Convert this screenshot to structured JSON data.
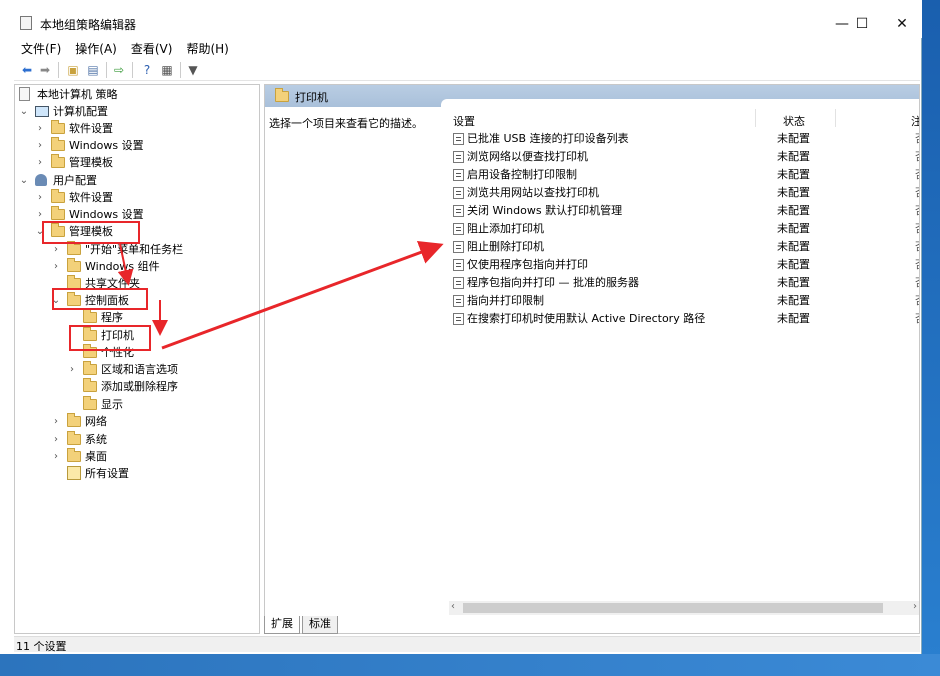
{
  "window": {
    "title": "本地组策略编辑器",
    "minimize": "—",
    "maximize": "☐",
    "close": "✕"
  },
  "menu": [
    "文件(F)",
    "操作(A)",
    "查看(V)",
    "帮助(H)"
  ],
  "tree": {
    "root": "本地计算机 策略",
    "computer_config": "计算机配置",
    "cc_software": "软件设置",
    "cc_windows": "Windows 设置",
    "cc_admin": "管理模板",
    "user_config": "用户配置",
    "uc_software": "软件设置",
    "uc_windows": "Windows 设置",
    "uc_admin": "管理模板",
    "start_menu": "\"开始\"菜单和任务栏",
    "win_components": "Windows 组件",
    "shared_folders": "共享文件夹",
    "control_panel": "控制面板",
    "programs": "程序",
    "printers": "打印机",
    "personalization": "个性化",
    "region_lang": "区域和语言选项",
    "add_remove": "添加或删除程序",
    "display": "显示",
    "network": "网络",
    "system": "系统",
    "desktop": "桌面",
    "all_settings": "所有设置"
  },
  "panel": {
    "header": "打印机",
    "description": "选择一个项目来查看它的描述。",
    "col_setting": "设置",
    "col_state": "状态",
    "col_note": "注",
    "rows": [
      {
        "name": "已批准 USB 连接的打印设备列表",
        "state": "未配置",
        "note": "否"
      },
      {
        "name": "浏览网络以便查找打印机",
        "state": "未配置",
        "note": "否"
      },
      {
        "name": "启用设备控制打印限制",
        "state": "未配置",
        "note": "否"
      },
      {
        "name": "浏览共用网站以查找打印机",
        "state": "未配置",
        "note": "否"
      },
      {
        "name": "关闭 Windows 默认打印机管理",
        "state": "未配置",
        "note": "否"
      },
      {
        "name": "阻止添加打印机",
        "state": "未配置",
        "note": "否"
      },
      {
        "name": "阻止删除打印机",
        "state": "未配置",
        "note": "否"
      },
      {
        "name": "仅使用程序包指向并打印",
        "state": "未配置",
        "note": "否"
      },
      {
        "name": "程序包指向并打印 — 批准的服务器",
        "state": "未配置",
        "note": "否"
      },
      {
        "name": "指向并打印限制",
        "state": "未配置",
        "note": "否"
      },
      {
        "name": "在搜索打印机时使用默认 Active Directory 路径",
        "state": "未配置",
        "note": "否"
      }
    ]
  },
  "tabs": [
    "扩展",
    "标准"
  ],
  "status": "11 个设置",
  "colors": {
    "highlight": "#e8262a",
    "header_bg": "#b9cde3",
    "folder": "#f3d17a"
  }
}
